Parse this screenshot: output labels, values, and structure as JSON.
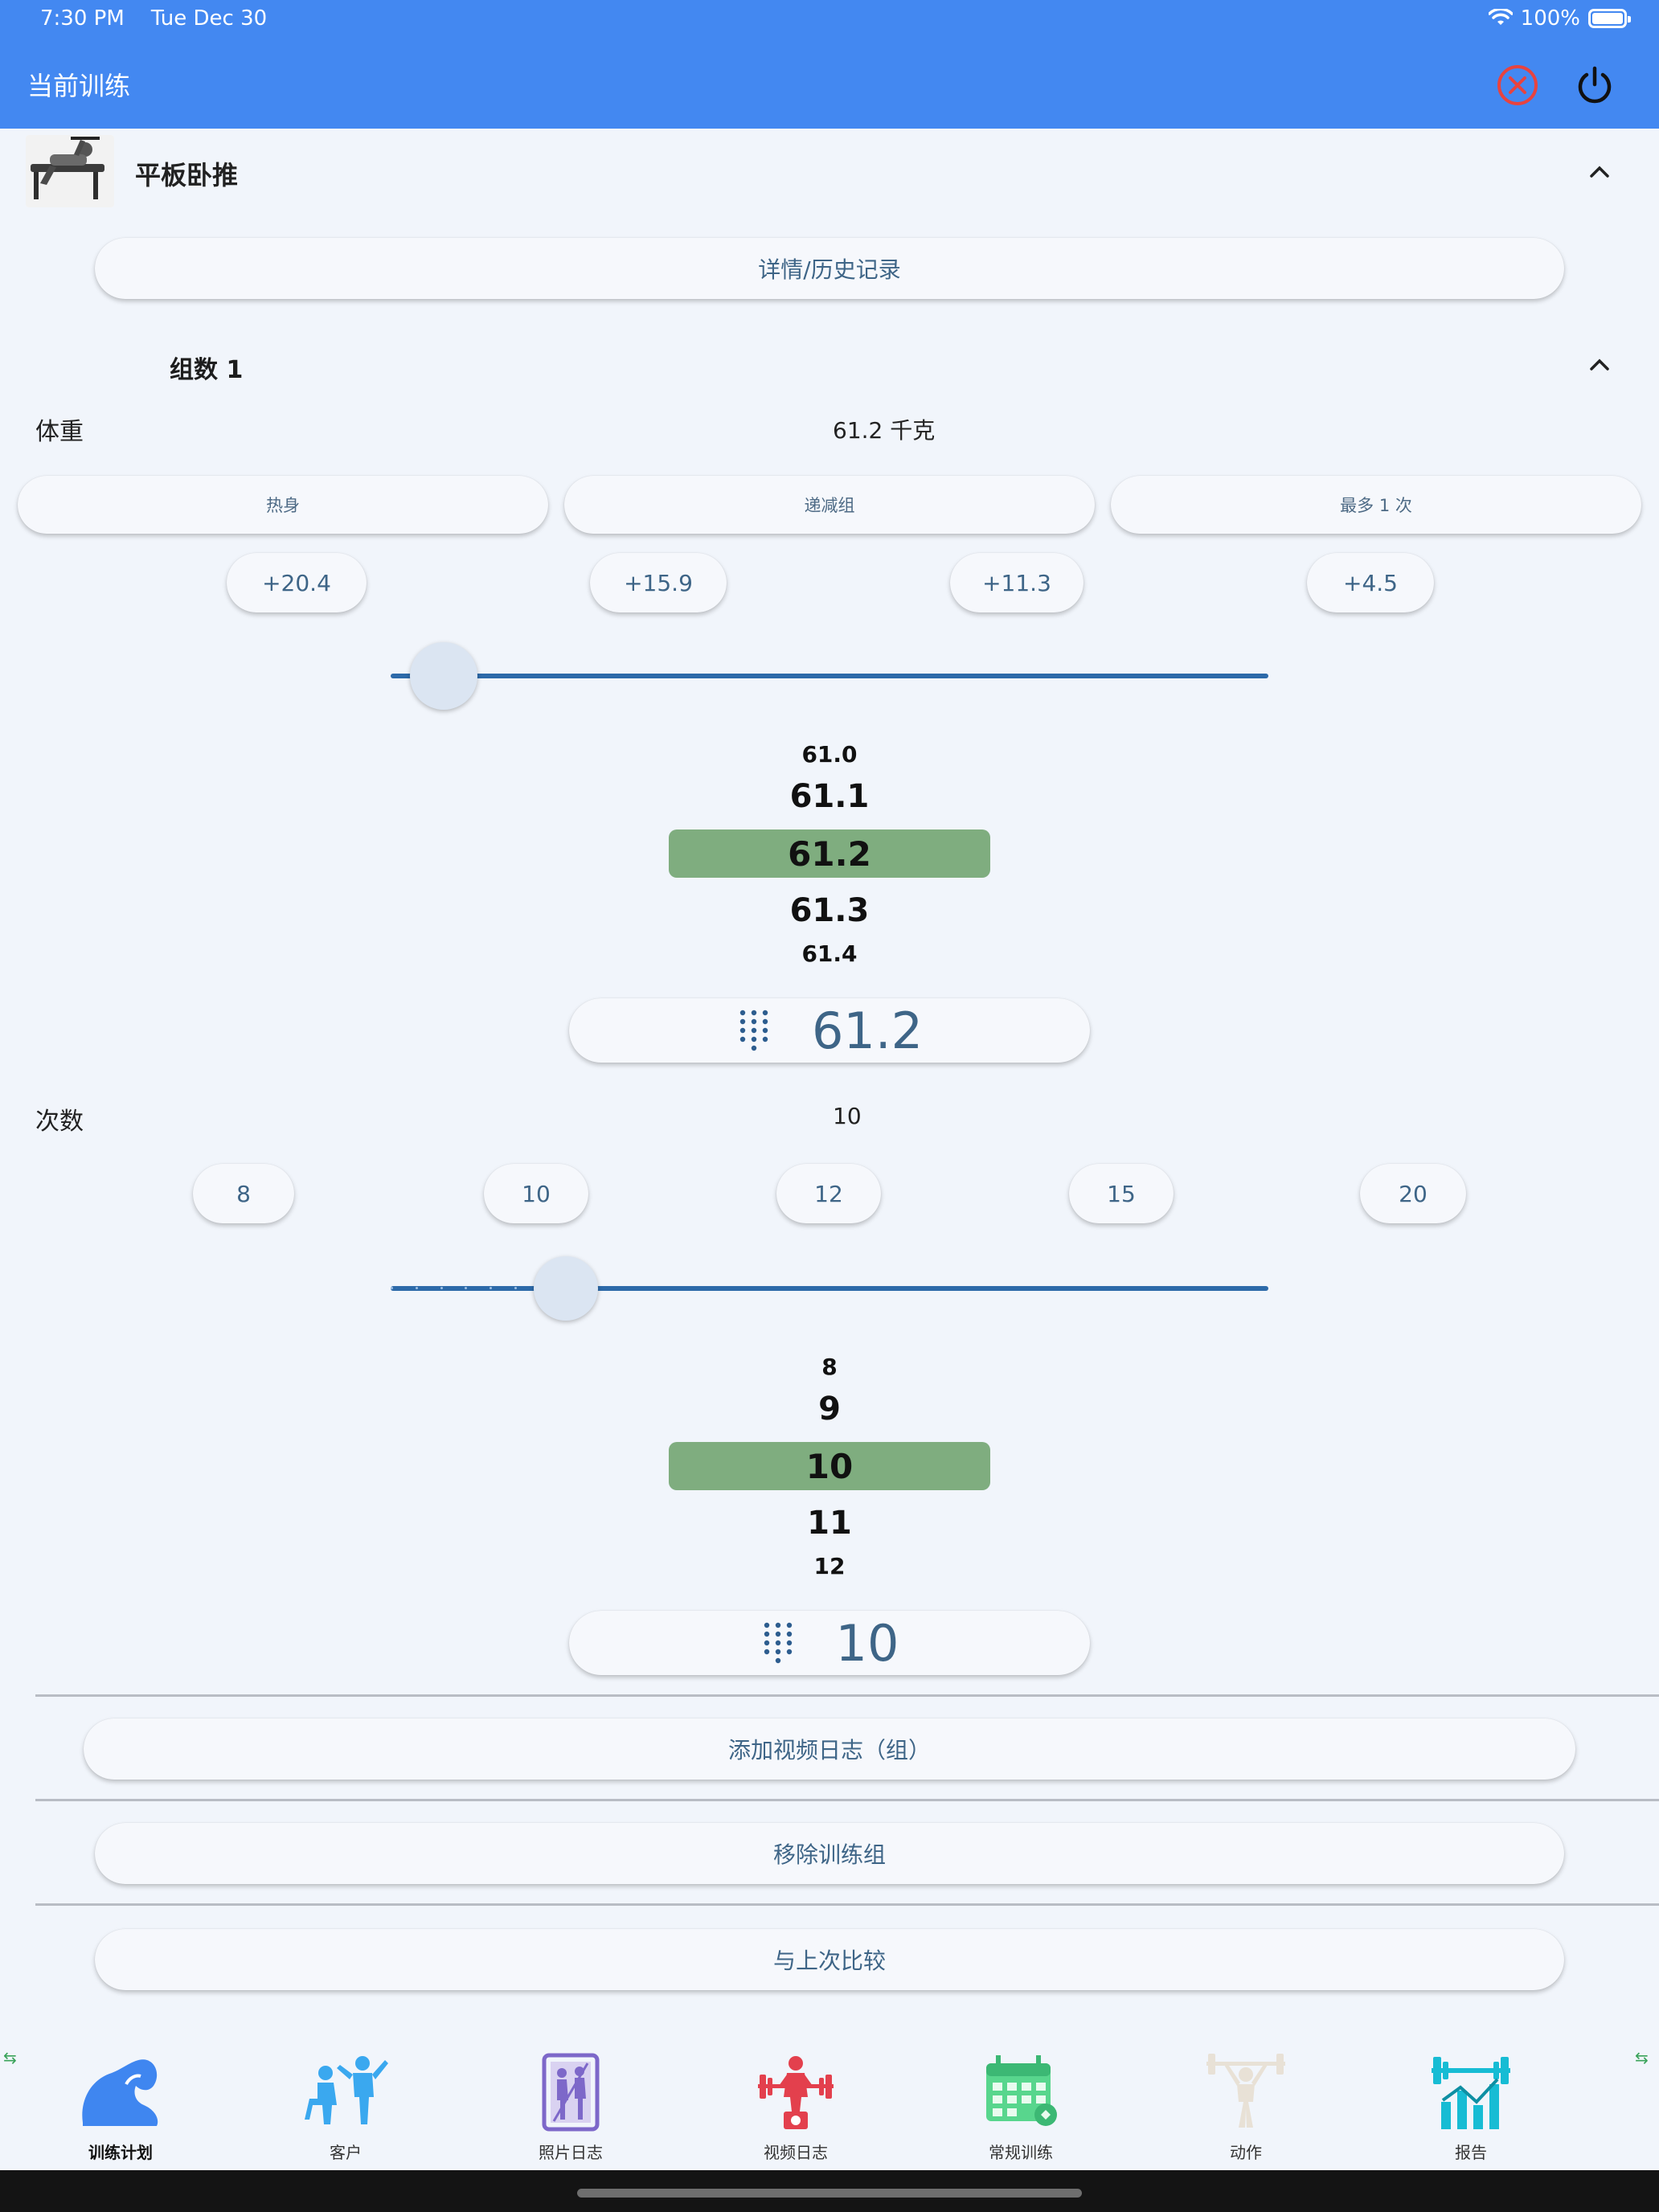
{
  "status_bar": {
    "time": "7:30 PM",
    "date": "Tue Dec 30",
    "battery": "100%"
  },
  "app": {
    "title": "当前训练"
  },
  "exercise": {
    "name": "平板卧推",
    "details_button": "详情/历史记录"
  },
  "set": {
    "title": "组数 1",
    "weight": {
      "label": "体重",
      "value": "61.2 千克",
      "presets": [
        "热身",
        "递减组",
        "最多 1 次"
      ],
      "increments": [
        "+20.4",
        "+15.9",
        "+11.3",
        "+4.5"
      ],
      "slider_fraction": 0.06,
      "wheel": [
        "61.0",
        "61.1",
        "61.2",
        "61.3",
        "61.4"
      ],
      "input_value": "61.2"
    },
    "reps": {
      "label": "次数",
      "value": "10",
      "quick": [
        "8",
        "10",
        "12",
        "15",
        "20"
      ],
      "slider_fraction": 0.2,
      "wheel": [
        "8",
        "9",
        "10",
        "11",
        "12"
      ],
      "input_value": "10"
    }
  },
  "actions": {
    "add_video": "添加视频日志（组）",
    "remove_set": "移除训练组",
    "compare": "与上次比较"
  },
  "nav": [
    {
      "label": "训练计划",
      "icon": "flexed-arm-icon",
      "color": "#3f86f0",
      "active": true
    },
    {
      "label": "客户",
      "icon": "trainer-client-icon",
      "color": "#3aa8ef",
      "active": false
    },
    {
      "label": "照片日志",
      "icon": "photo-log-icon",
      "color": "#7d68c9",
      "active": false
    },
    {
      "label": "视频日志",
      "icon": "weightlifter-video-icon",
      "color": "#e3404d",
      "active": false
    },
    {
      "label": "常规训练",
      "icon": "calendar-routine-icon",
      "color": "#58d68d",
      "active": false
    },
    {
      "label": "动作",
      "icon": "lifter-exercise-icon",
      "color": "#e8e1d6",
      "active": false
    },
    {
      "label": "报告",
      "icon": "report-chart-icon",
      "color": "#17bcd4",
      "active": false
    }
  ],
  "colors": {
    "header": "#4388f1",
    "selected_wheel": "#7fad7f",
    "slider": "#2d6aa9"
  }
}
